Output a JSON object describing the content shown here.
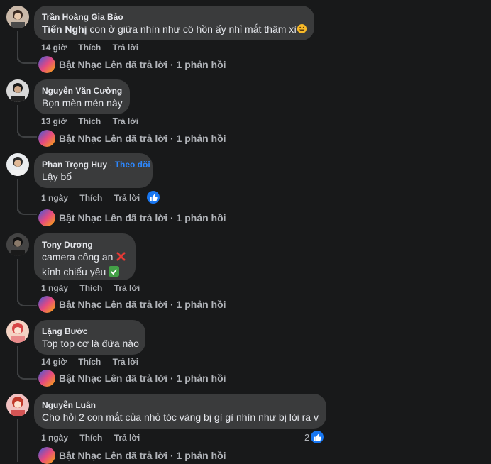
{
  "comments": [
    {
      "author": "Trần Hoàng Gia Bảo",
      "mention": "Tiến Nghị",
      "text": " con ở giữa nhìn như cô hồn ấy nhỉ mắt thâm xì",
      "emoji": "rofl-emoji",
      "time": "14 giờ",
      "like": "Thích",
      "reply": "Trả lời",
      "reply_summary": "Bật Nhạc Lên đã trả lời · 1 phản hồi"
    },
    {
      "author": "Nguyễn Văn Cường",
      "text": "Bọn mèn mén này",
      "time": "13 giờ",
      "like": "Thích",
      "reply": "Trả lời",
      "reply_summary": "Bật Nhạc Lên đã trả lời · 1 phản hồi"
    },
    {
      "author": "Phan Trọng Huy",
      "follow": "Theo dõi",
      "text": "Lậy bố",
      "time": "1 ngày",
      "like": "Thích",
      "reply": "Trả lời",
      "reactions": 1,
      "reply_summary": "Bật Nhạc Lên đã trả lời · 1 phản hồi"
    },
    {
      "author": "Tony Dương",
      "line1": "camera công an",
      "line1_icon": "red-cross-icon",
      "line2": "kính chiếu yêu",
      "line2_icon": "green-check-icon",
      "time": "1 ngày",
      "like": "Thích",
      "reply": "Trả lời",
      "reply_summary": "Bật Nhạc Lên đã trả lời · 1 phản hồi"
    },
    {
      "author": "Lặng Bước",
      "text": "Top top cơ là đứa nào",
      "time": "14 giờ",
      "like": "Thích",
      "reply": "Trả lời",
      "reply_summary": "Bật Nhạc Lên đã trả lời · 1 phản hồi"
    },
    {
      "author": "Nguyễn Luân",
      "text": "Cho hỏi 2 con mắt của nhỏ tóc vàng bị gì gì nhìn như bị lòi ra v",
      "time": "1 ngày",
      "like": "Thích",
      "reply": "Trả lời",
      "reaction_count": "2",
      "reply_summary": "Bật Nhạc Lên đã trả lời · 1 phản hồi"
    }
  ],
  "colors": {
    "background": "#18191a",
    "bubble": "#3a3b3c",
    "secondary_text": "#b0b3b8",
    "link": "#2d88ff",
    "like_blue": "#1877f2"
  }
}
